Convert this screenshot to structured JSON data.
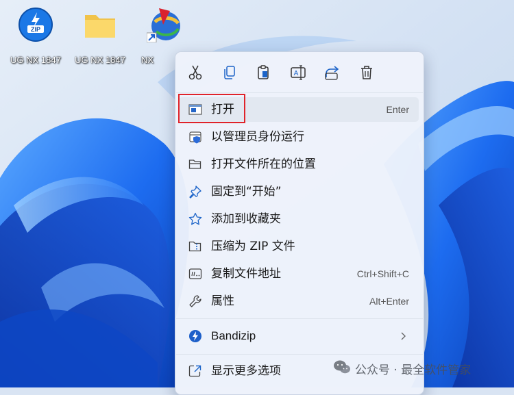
{
  "desktop": {
    "icons": [
      {
        "label": "UG NX 1847",
        "icon": "zip-archive-icon"
      },
      {
        "label": "UG NX 1847",
        "icon": "folder-icon"
      },
      {
        "label": "NX",
        "icon": "nx-app-shortcut-icon"
      }
    ]
  },
  "context_menu": {
    "toolbar": [
      "cut-icon",
      "copy-icon",
      "paste-icon",
      "rename-icon",
      "share-icon",
      "delete-icon"
    ],
    "items": [
      {
        "label": "打开",
        "shortcut": "Enter",
        "icon": "open-window-icon"
      },
      {
        "label": "以管理员身份运行",
        "shortcut": "",
        "icon": "admin-shield-icon"
      },
      {
        "label": "打开文件所在的位置",
        "shortcut": "",
        "icon": "folder-open-icon"
      },
      {
        "label": "固定到“开始”",
        "shortcut": "",
        "icon": "pin-icon"
      },
      {
        "label": "添加到收藏夹",
        "shortcut": "",
        "icon": "star-icon"
      },
      {
        "label": "压缩为 ZIP 文件",
        "shortcut": "",
        "icon": "zip-folder-icon"
      },
      {
        "label": "复制文件地址",
        "shortcut": "Ctrl+Shift+C",
        "icon": "copy-path-icon"
      },
      {
        "label": "属性",
        "shortcut": "Alt+Enter",
        "icon": "wrench-icon"
      },
      {
        "label": "Bandizip",
        "shortcut": "",
        "icon": "bandizip-icon"
      },
      {
        "label": "显示更多选项",
        "shortcut": "",
        "icon": "more-options-icon"
      }
    ]
  },
  "watermark": {
    "text": "公众号 · 最全软件管家",
    "icon": "wechat-icon"
  },
  "colors": {
    "highlight_border": "#e0232a",
    "accent": "#0067c0",
    "menu_bg": "#eef3fb"
  }
}
